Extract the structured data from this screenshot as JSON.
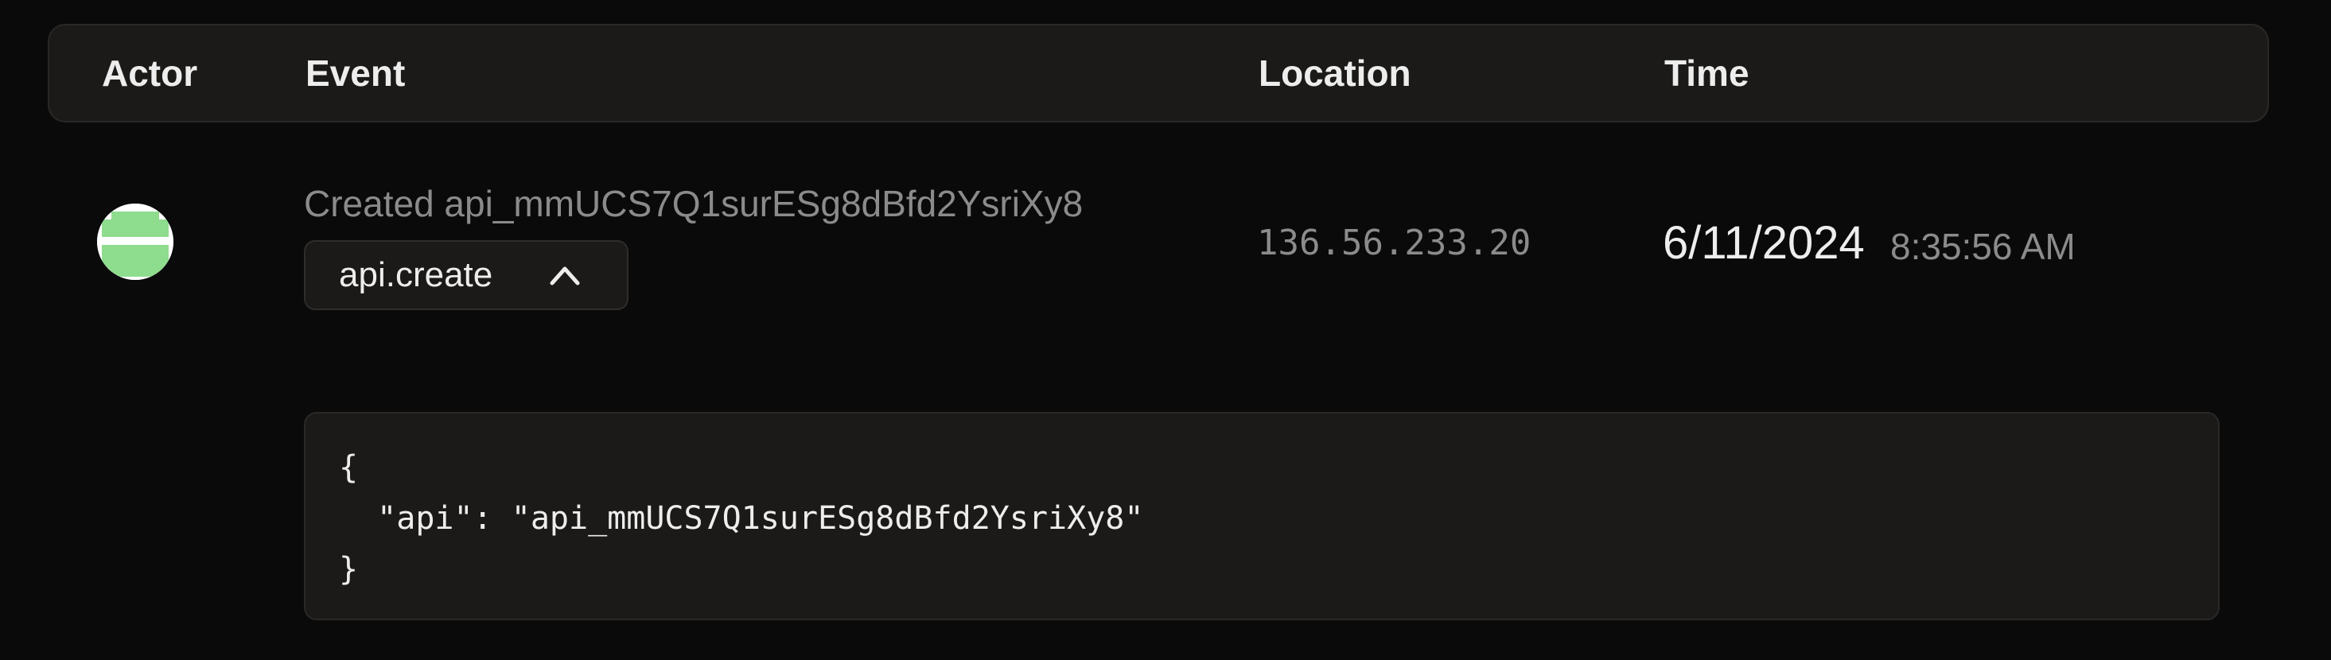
{
  "table": {
    "headers": {
      "actor": "Actor",
      "event": "Event",
      "location": "Location",
      "time": "Time"
    }
  },
  "row": {
    "actor": {
      "avatar_icon": "identicon-avatar",
      "avatar_colors": [
        "#8edc8e",
        "#ffffff"
      ]
    },
    "event": {
      "description": "Created api_mmUCS7Q1surESg8dBfd2YsriXy8",
      "type": "api.create",
      "toggle_icon": "chevron-up-icon"
    },
    "location": "136.56.233.20",
    "time": {
      "date": "6/11/2024",
      "clock": "8:35:56 AM"
    },
    "details_json": "{\n  \"api\": \"api_mmUCS7Q1surESg8dBfd2YsriXy8\"\n}"
  },
  "colors": {
    "background": "#0a0a0a",
    "surface": "#1c1a18",
    "border": "#2a2826",
    "text": "#ededed",
    "muted_text": "#8b8b8b"
  }
}
